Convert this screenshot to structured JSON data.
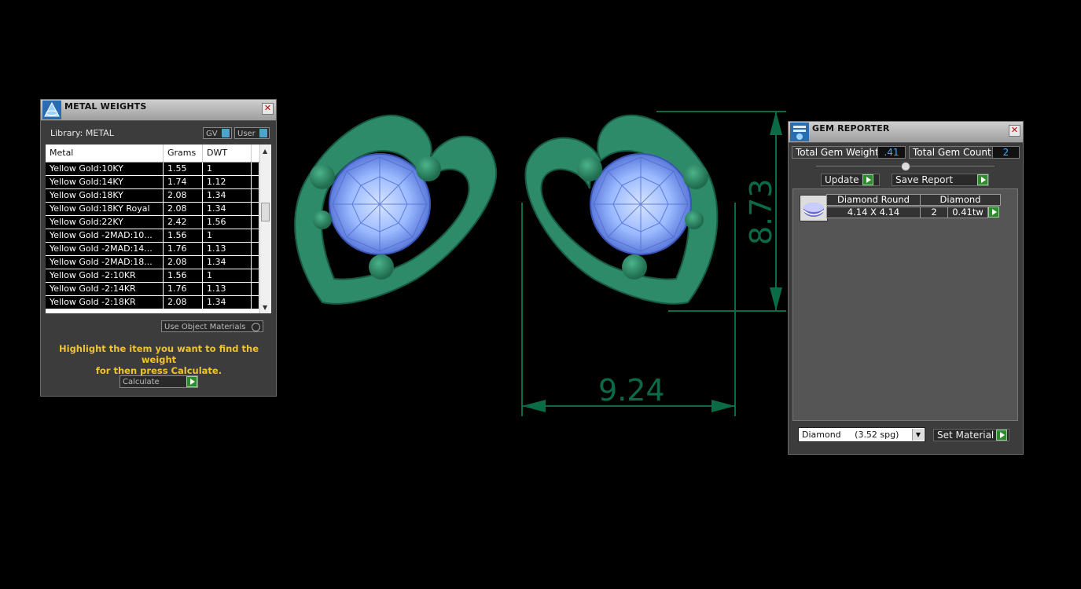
{
  "metal_weights": {
    "title": "METAL WEIGHTS",
    "library_label": "Library: METAL",
    "gv_label": "GV",
    "user_label": "User",
    "columns": [
      "Metal",
      "Grams",
      "DWT"
    ],
    "rows": [
      [
        "Yellow Gold:10KY",
        "1.55",
        "1"
      ],
      [
        "Yellow Gold:14KY",
        "1.74",
        "1.12"
      ],
      [
        "Yellow Gold:18KY",
        "2.08",
        "1.34"
      ],
      [
        "Yellow Gold:18KY Royal",
        "2.08",
        "1.34"
      ],
      [
        "Yellow Gold:22KY",
        "2.42",
        "1.56"
      ],
      [
        "Yellow Gold -2MAD:10...",
        "1.56",
        "1"
      ],
      [
        "Yellow Gold -2MAD:14...",
        "1.76",
        "1.13"
      ],
      [
        "Yellow Gold -2MAD:18...",
        "2.08",
        "1.34"
      ],
      [
        "Yellow Gold -2:10KR",
        "1.56",
        "1"
      ],
      [
        "Yellow Gold -2:14KR",
        "1.76",
        "1.13"
      ],
      [
        "Yellow Gold -2:18KR",
        "2.08",
        "1.34"
      ]
    ],
    "use_object_materials": "Use Object Materials",
    "hint_line1": "Highlight the item you want to find the weight",
    "hint_line2": "for then press Calculate.",
    "calculate_label": "Calculate"
  },
  "viewport": {
    "width_dimension": "9.24",
    "height_dimension": "8.73",
    "model_color": "#2e8b6a",
    "gem_color": "#8fb4ff"
  },
  "gem_reporter": {
    "title": "GEM REPORTER",
    "total_weight_label": "Total Gem Weight",
    "total_weight_value": ".41",
    "total_count_label": "Total Gem Count",
    "total_count_value": "2",
    "update_label": "Update",
    "save_report_label": "Save Report",
    "gem": {
      "shape": "Diamond Round",
      "material": "Diamond",
      "size": "4.14 X 4.14",
      "count": "2",
      "weight": "0.41tw"
    },
    "material_select": "Diamond     (3.52 spg)",
    "set_material_label": "Set Material"
  }
}
